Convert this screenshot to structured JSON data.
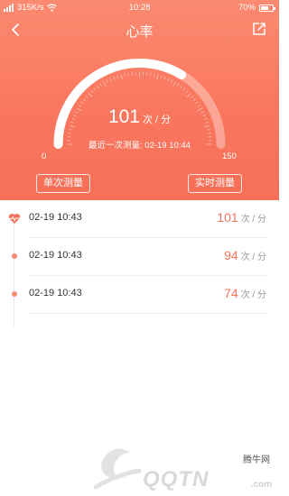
{
  "status_bar": {
    "network_speed": "315K/s",
    "time": "10:28",
    "battery": "70%",
    "battery_level": 0.7
  },
  "nav": {
    "title": "心率",
    "back_icon": "chevron-left-icon",
    "share_icon": "share-icon"
  },
  "gauge": {
    "value": "101",
    "unit": "次 / 分",
    "last_measured_label": "最近一次测量:",
    "last_measured_time": "02-19 10:44",
    "min": "0",
    "max": "150",
    "current_fraction": 0.673
  },
  "buttons": {
    "single_label": "单次测量",
    "realtime_label": "实时测量"
  },
  "records": [
    {
      "time": "02-19 10:43",
      "value": "101",
      "unit": "次 / 分",
      "icon": "heartbeat-icon"
    },
    {
      "time": "02-19 10:43",
      "value": "94",
      "unit": "次 / 分",
      "icon": "dot-icon"
    },
    {
      "time": "02-19 10:43",
      "value": "74",
      "unit": "次 / 分",
      "icon": "dot-icon"
    }
  ],
  "watermark": {
    "cn": "腾牛网",
    "en": "QQTN",
    "com": ".com"
  },
  "colors": {
    "accent": "#f9775e",
    "value_text": "#f7745c"
  }
}
